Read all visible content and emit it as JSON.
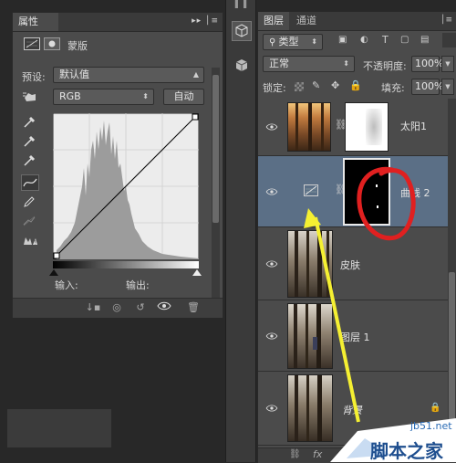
{
  "properties": {
    "tab_title": "属性",
    "panel_title": "蒙版",
    "preset_label": "预设:",
    "preset_value": "默认值",
    "channel_value": "RGB",
    "auto_button": "自动",
    "input_label": "输入:",
    "output_label": "输出:"
  },
  "layers_panel": {
    "tabs": [
      "图层",
      "通道"
    ],
    "filter_type": "类型",
    "blend_mode": "正常",
    "opacity_label": "不透明度:",
    "opacity_value": "100%",
    "lock_label": "锁定:",
    "fill_label": "填充:",
    "fill_value": "100%",
    "layers": [
      {
        "name": "太阳1",
        "selected": false
      },
      {
        "name": "曲线 2",
        "selected": true
      },
      {
        "name": "皮肤",
        "selected": false
      },
      {
        "name": "图层 1",
        "selected": false
      },
      {
        "name": "背景",
        "selected": false
      }
    ]
  },
  "annotations": {
    "circle_color": "#e02020",
    "arrow_color": "#f5f032"
  },
  "watermark": {
    "site": "jb51.net",
    "brand": "脚本之家"
  }
}
